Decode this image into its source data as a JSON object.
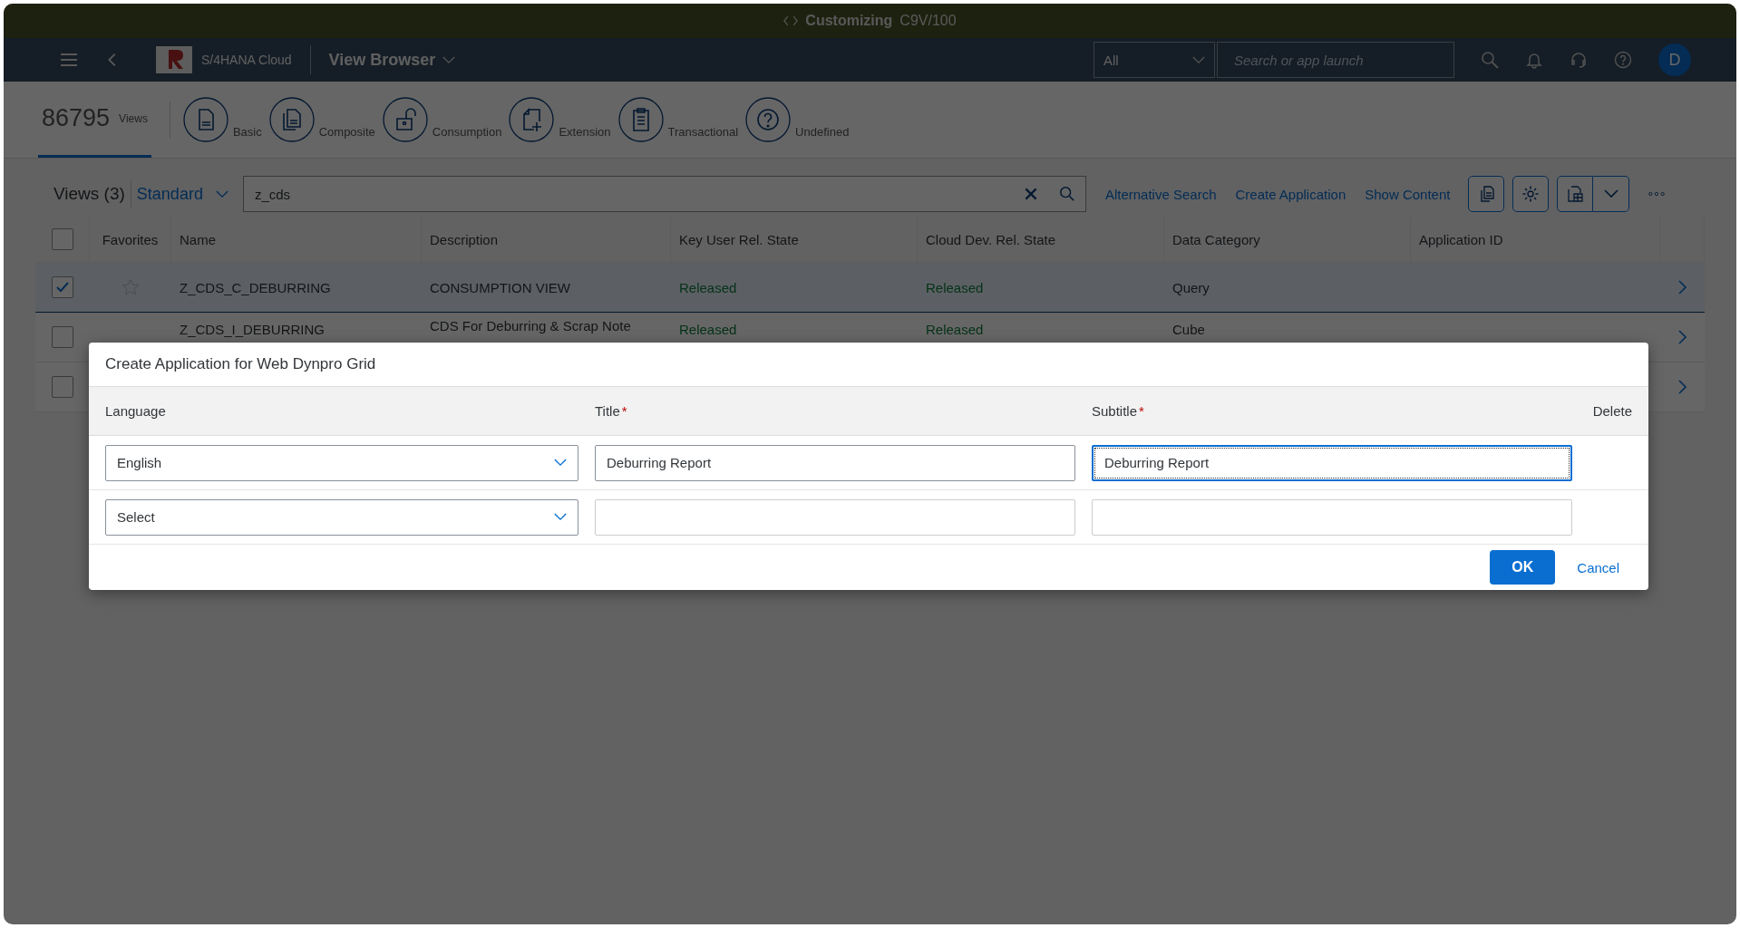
{
  "system_bar": {
    "title": "Customizing",
    "system": "C9V/100"
  },
  "shell": {
    "product": "S/4HANA Cloud",
    "app_title": "View Browser",
    "scope": "All",
    "search_placeholder": "Search or app launch",
    "avatar": "D"
  },
  "header": {
    "count": "86795",
    "count_label": "Views",
    "categories": [
      {
        "label": "Basic",
        "kind": "document"
      },
      {
        "label": "Composite",
        "kind": "copies"
      },
      {
        "label": "Consumption",
        "kind": "unlock"
      },
      {
        "label": "Extension",
        "kind": "addition"
      },
      {
        "label": "Transactional",
        "kind": "clipboard"
      },
      {
        "label": "Undefined",
        "kind": "question"
      }
    ]
  },
  "toolbar": {
    "title": "Views (3)",
    "variant": "Standard",
    "search_value": "z_cds",
    "actions": [
      "Alternative Search",
      "Create Application",
      "Show Content"
    ]
  },
  "table": {
    "all_selected": false,
    "columns": [
      "Favorites",
      "Name",
      "Description",
      "Key User Rel. State",
      "Cloud Dev. Rel. State",
      "Data Category",
      "Application ID"
    ],
    "rows": [
      {
        "selected": true,
        "favorite": false,
        "name": "Z_CDS_C_DEBURRING",
        "description": "CONSUMPTION VIEW",
        "key_user_state": "Released",
        "cloud_state": "Released",
        "category": "Query"
      },
      {
        "selected": false,
        "name": "Z_CDS_I_DEBURRING",
        "description": "CDS For Deburring & Scrap Note",
        "key_user_state": "Released",
        "cloud_state": "Released",
        "category": "Cube"
      },
      {
        "selected": false
      }
    ]
  },
  "dialog": {
    "title": "Create Application for Web Dynpro Grid",
    "columns": [
      {
        "label": "Language",
        "required": false
      },
      {
        "label": "Title",
        "required": true
      },
      {
        "label": "Subtitle",
        "required": true
      },
      {
        "label": "Delete",
        "required": false
      }
    ],
    "rows": [
      {
        "language": "English",
        "title": "Deburring Report",
        "subtitle": "Deburring Report",
        "subtitle_focused": true
      },
      {
        "language": "Select",
        "subtitle_focused": false
      }
    ],
    "required_mark": "*",
    "ok": "OK",
    "cancel": "Cancel"
  }
}
